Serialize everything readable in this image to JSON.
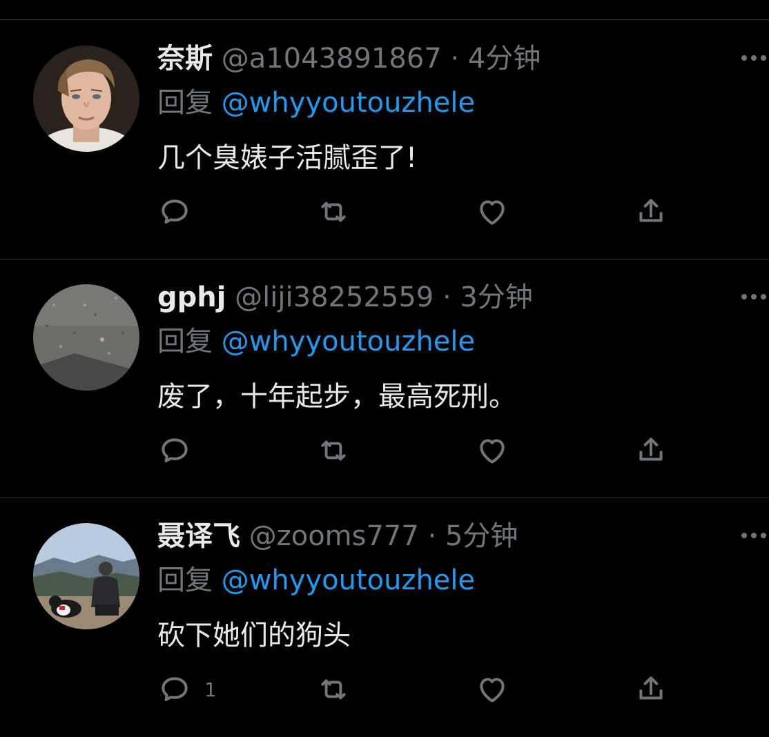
{
  "tweets": [
    {
      "name": "奈斯",
      "handle": "@a1043891867",
      "separator": "·",
      "time": "4分钟",
      "reply_label": "回复",
      "reply_to": "@whyyoutouzhele",
      "text": "几个臭婊子活腻歪了!",
      "reply_count": "",
      "avatar": "portrait-young-man"
    },
    {
      "name": "gphj",
      "handle": "@liji38252559",
      "separator": "·",
      "time": "3分钟",
      "reply_label": "回复",
      "reply_to": "@whyyoutouzhele",
      "text": "废了，十年起步，最高死刑。",
      "reply_count": "",
      "avatar": "granite-stone"
    },
    {
      "name": "聂译飞",
      "handle": "@zooms777",
      "separator": "·",
      "time": "5分钟",
      "reply_label": "回复",
      "reply_to": "@whyyoutouzhele",
      "text": "砍下她们的狗头",
      "reply_count": "1",
      "avatar": "man-with-dog-mountains"
    }
  ],
  "colors": {
    "background": "#000000",
    "text": "#e7e9ea",
    "muted": "#71767b",
    "accent": "#1d9bf0",
    "divider": "#2f3336"
  },
  "icons": [
    "reply-icon",
    "retweet-icon",
    "like-icon",
    "share-icon",
    "more-icon"
  ]
}
